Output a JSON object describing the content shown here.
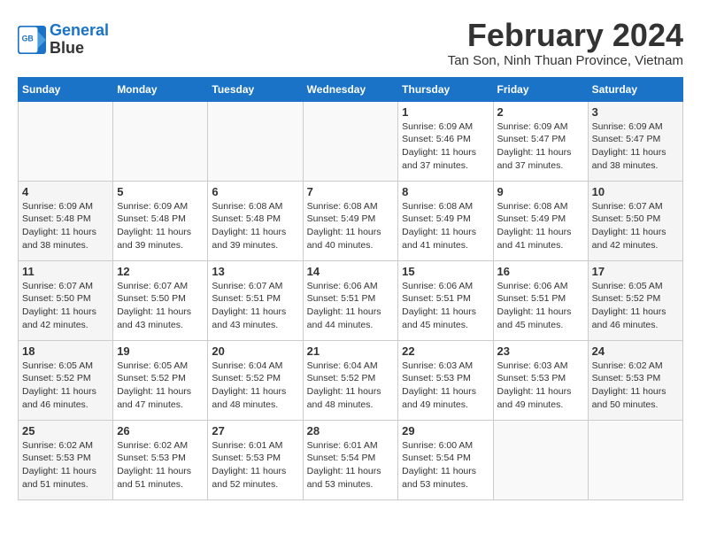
{
  "header": {
    "logo_line1": "General",
    "logo_line2": "Blue",
    "title": "February 2024",
    "subtitle": "Tan Son, Ninh Thuan Province, Vietnam"
  },
  "days_of_week": [
    "Sunday",
    "Monday",
    "Tuesday",
    "Wednesday",
    "Thursday",
    "Friday",
    "Saturday"
  ],
  "weeks": [
    [
      {
        "day": "",
        "info": ""
      },
      {
        "day": "",
        "info": ""
      },
      {
        "day": "",
        "info": ""
      },
      {
        "day": "",
        "info": ""
      },
      {
        "day": "1",
        "info": "Sunrise: 6:09 AM\nSunset: 5:46 PM\nDaylight: 11 hours and 37 minutes."
      },
      {
        "day": "2",
        "info": "Sunrise: 6:09 AM\nSunset: 5:47 PM\nDaylight: 11 hours and 37 minutes."
      },
      {
        "day": "3",
        "info": "Sunrise: 6:09 AM\nSunset: 5:47 PM\nDaylight: 11 hours and 38 minutes."
      }
    ],
    [
      {
        "day": "4",
        "info": "Sunrise: 6:09 AM\nSunset: 5:48 PM\nDaylight: 11 hours and 38 minutes."
      },
      {
        "day": "5",
        "info": "Sunrise: 6:09 AM\nSunset: 5:48 PM\nDaylight: 11 hours and 39 minutes."
      },
      {
        "day": "6",
        "info": "Sunrise: 6:08 AM\nSunset: 5:48 PM\nDaylight: 11 hours and 39 minutes."
      },
      {
        "day": "7",
        "info": "Sunrise: 6:08 AM\nSunset: 5:49 PM\nDaylight: 11 hours and 40 minutes."
      },
      {
        "day": "8",
        "info": "Sunrise: 6:08 AM\nSunset: 5:49 PM\nDaylight: 11 hours and 41 minutes."
      },
      {
        "day": "9",
        "info": "Sunrise: 6:08 AM\nSunset: 5:49 PM\nDaylight: 11 hours and 41 minutes."
      },
      {
        "day": "10",
        "info": "Sunrise: 6:07 AM\nSunset: 5:50 PM\nDaylight: 11 hours and 42 minutes."
      }
    ],
    [
      {
        "day": "11",
        "info": "Sunrise: 6:07 AM\nSunset: 5:50 PM\nDaylight: 11 hours and 42 minutes."
      },
      {
        "day": "12",
        "info": "Sunrise: 6:07 AM\nSunset: 5:50 PM\nDaylight: 11 hours and 43 minutes."
      },
      {
        "day": "13",
        "info": "Sunrise: 6:07 AM\nSunset: 5:51 PM\nDaylight: 11 hours and 43 minutes."
      },
      {
        "day": "14",
        "info": "Sunrise: 6:06 AM\nSunset: 5:51 PM\nDaylight: 11 hours and 44 minutes."
      },
      {
        "day": "15",
        "info": "Sunrise: 6:06 AM\nSunset: 5:51 PM\nDaylight: 11 hours and 45 minutes."
      },
      {
        "day": "16",
        "info": "Sunrise: 6:06 AM\nSunset: 5:51 PM\nDaylight: 11 hours and 45 minutes."
      },
      {
        "day": "17",
        "info": "Sunrise: 6:05 AM\nSunset: 5:52 PM\nDaylight: 11 hours and 46 minutes."
      }
    ],
    [
      {
        "day": "18",
        "info": "Sunrise: 6:05 AM\nSunset: 5:52 PM\nDaylight: 11 hours and 46 minutes."
      },
      {
        "day": "19",
        "info": "Sunrise: 6:05 AM\nSunset: 5:52 PM\nDaylight: 11 hours and 47 minutes."
      },
      {
        "day": "20",
        "info": "Sunrise: 6:04 AM\nSunset: 5:52 PM\nDaylight: 11 hours and 48 minutes."
      },
      {
        "day": "21",
        "info": "Sunrise: 6:04 AM\nSunset: 5:52 PM\nDaylight: 11 hours and 48 minutes."
      },
      {
        "day": "22",
        "info": "Sunrise: 6:03 AM\nSunset: 5:53 PM\nDaylight: 11 hours and 49 minutes."
      },
      {
        "day": "23",
        "info": "Sunrise: 6:03 AM\nSunset: 5:53 PM\nDaylight: 11 hours and 49 minutes."
      },
      {
        "day": "24",
        "info": "Sunrise: 6:02 AM\nSunset: 5:53 PM\nDaylight: 11 hours and 50 minutes."
      }
    ],
    [
      {
        "day": "25",
        "info": "Sunrise: 6:02 AM\nSunset: 5:53 PM\nDaylight: 11 hours and 51 minutes."
      },
      {
        "day": "26",
        "info": "Sunrise: 6:02 AM\nSunset: 5:53 PM\nDaylight: 11 hours and 51 minutes."
      },
      {
        "day": "27",
        "info": "Sunrise: 6:01 AM\nSunset: 5:53 PM\nDaylight: 11 hours and 52 minutes."
      },
      {
        "day": "28",
        "info": "Sunrise: 6:01 AM\nSunset: 5:54 PM\nDaylight: 11 hours and 53 minutes."
      },
      {
        "day": "29",
        "info": "Sunrise: 6:00 AM\nSunset: 5:54 PM\nDaylight: 11 hours and 53 minutes."
      },
      {
        "day": "",
        "info": ""
      },
      {
        "day": "",
        "info": ""
      }
    ]
  ]
}
